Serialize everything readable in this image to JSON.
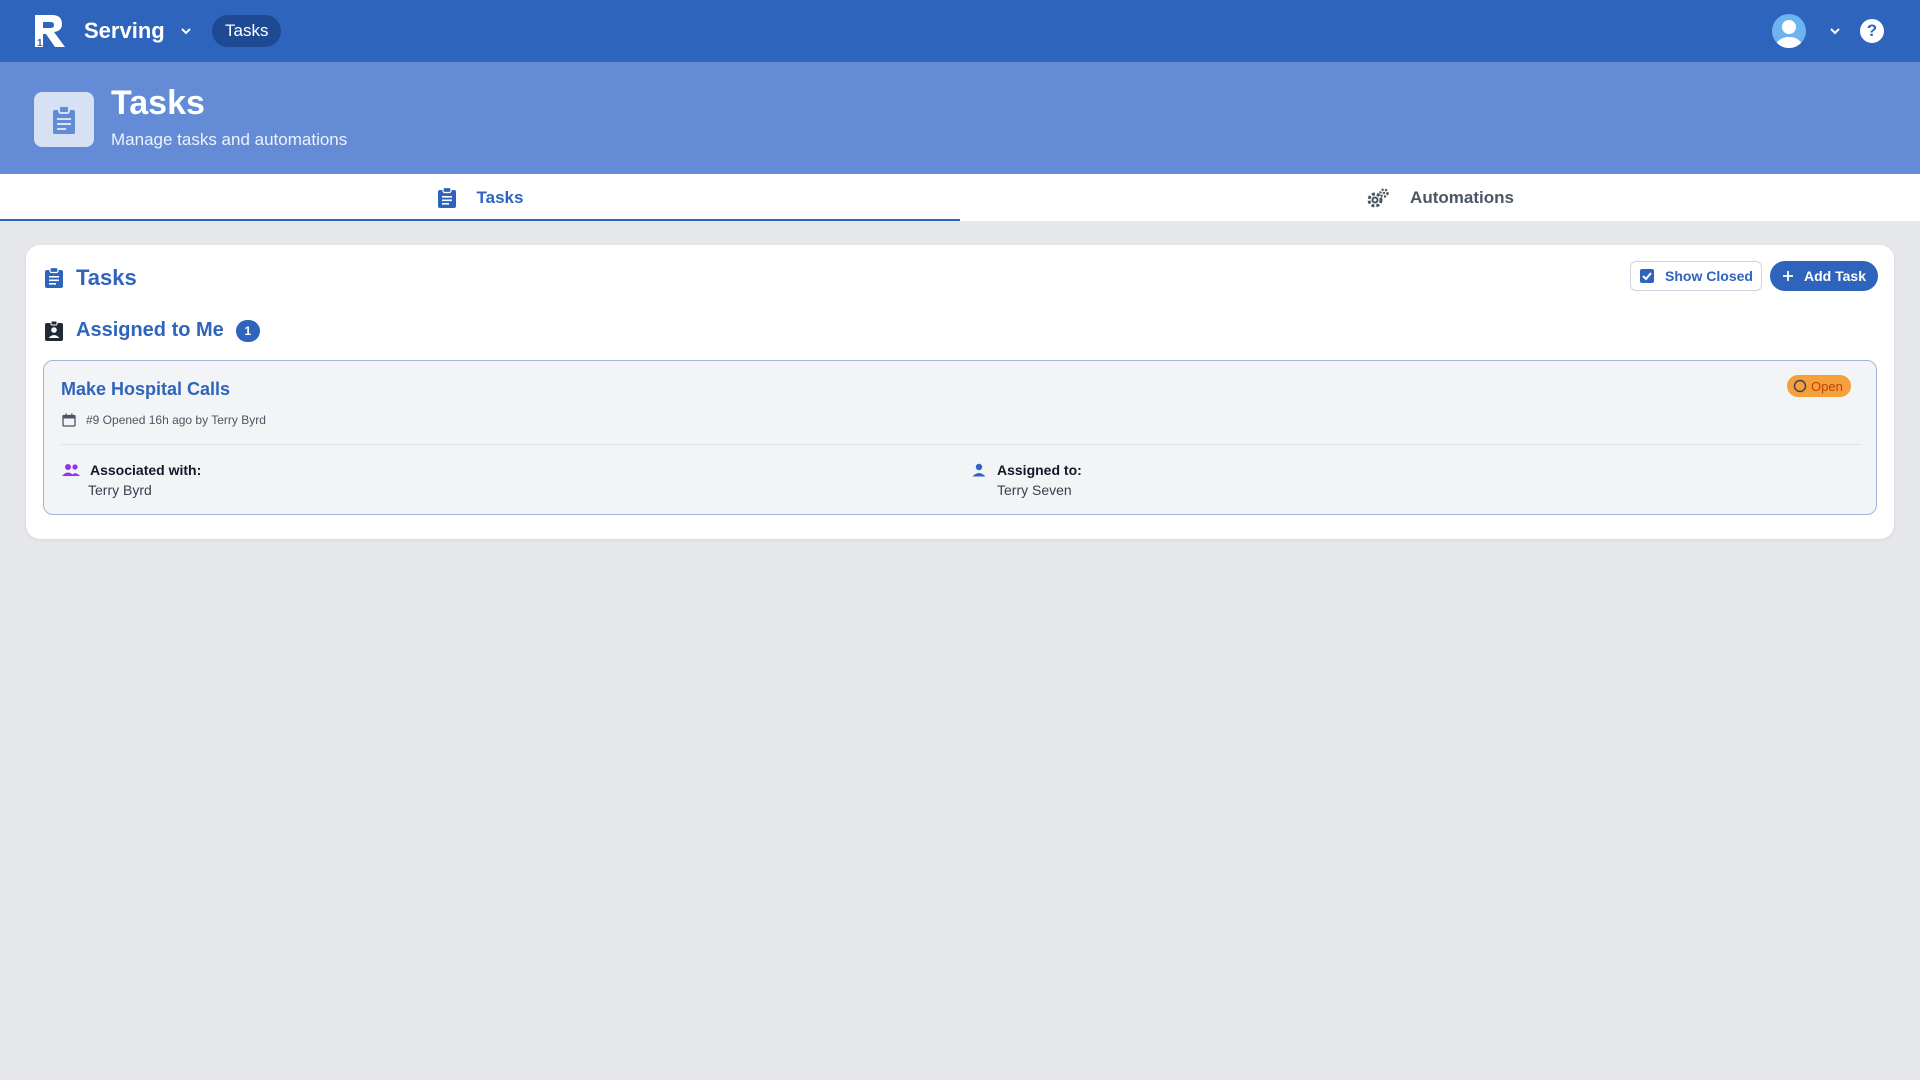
{
  "topbar": {
    "app_name": "Serving",
    "breadcrumb": "Tasks",
    "help_symbol": "?"
  },
  "header": {
    "title": "Tasks",
    "subtitle": "Manage tasks and automations"
  },
  "tabs": [
    {
      "label": "Tasks",
      "icon": "clipboard-icon",
      "active": true
    },
    {
      "label": "Automations",
      "icon": "gears-icon",
      "active": false
    }
  ],
  "card": {
    "title": "Tasks",
    "show_closed_label": "Show Closed",
    "show_closed_checked": true,
    "add_task_label": "Add Task",
    "section": {
      "title": "Assigned to Me",
      "count": "1"
    },
    "task": {
      "title": "Make Hospital Calls",
      "status": "Open",
      "meta": "#9 Opened 16h ago by Terry Byrd",
      "associated_label": "Associated with:",
      "associated_value": "Terry Byrd",
      "assigned_label": "Assigned to:",
      "assigned_value": "Terry Seven"
    }
  },
  "colors": {
    "primary": "#2f64bd",
    "header_band": "#648bd6",
    "status_open": "#f5a03a",
    "associated_icon": "#9333ea",
    "background": "#e5e7eb"
  }
}
